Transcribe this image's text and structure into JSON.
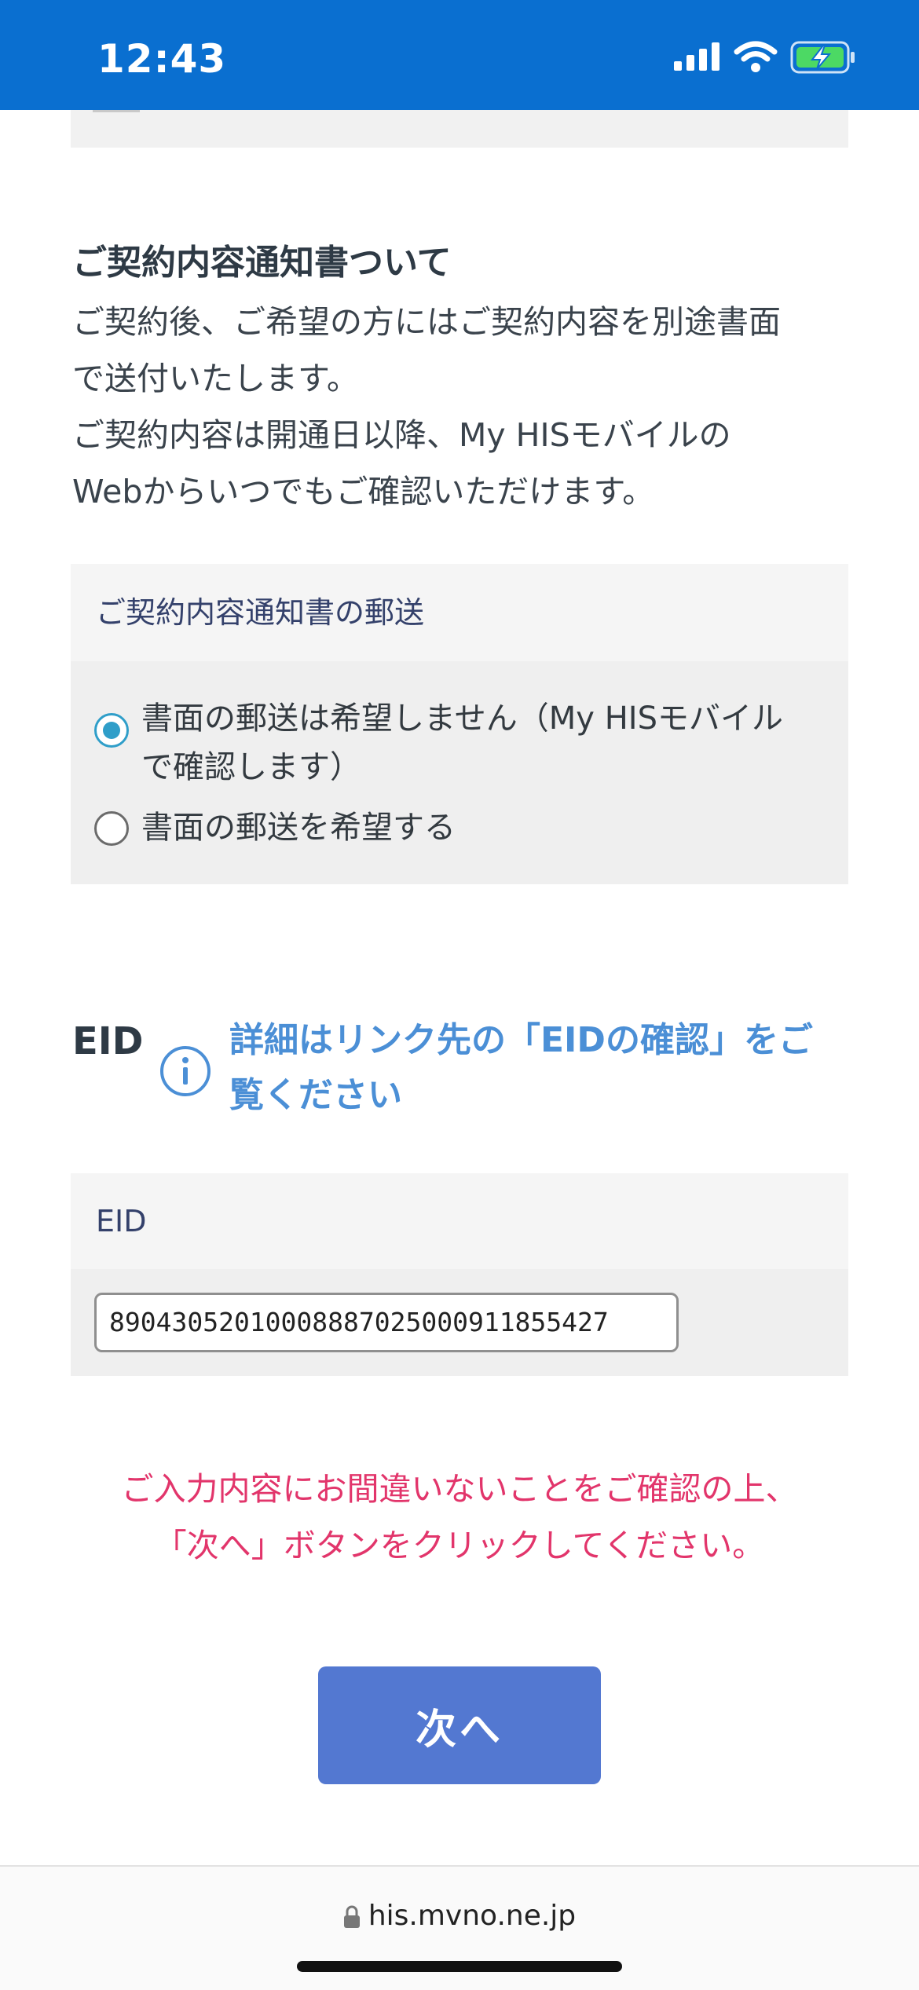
{
  "status_bar": {
    "time": "12:43",
    "icons": [
      "signal-icon",
      "wifi-icon",
      "battery-charging-icon"
    ],
    "color": "#0a6fd0"
  },
  "notification": {
    "title": "ご契約内容通知書ついて",
    "paragraph_lines": [
      "ご契約後、ご希望の方にはご契約内容を別途書面",
      "で送付いたします。",
      "ご契約内容は開通日以降、My HISモバイルの",
      "Webからいつでもご確認いただけます。"
    ],
    "card": {
      "header": "ご契約内容通知書の郵送",
      "options": [
        {
          "label_line1": "書面の郵送は希望しません（My HISモバイル",
          "label_line2": "で確認します）",
          "selected": true
        },
        {
          "label_line1": "書面の郵送を希望する",
          "selected": false
        }
      ]
    }
  },
  "eid": {
    "heading": "EID",
    "info_icon": "info-icon",
    "link_line1": "詳細はリンク先の「EIDの確認」をご",
    "link_line2": "覧ください",
    "card_header": "EID",
    "value": "89043052010008887025000911855427"
  },
  "warning": {
    "line1": "ご入力内容にお間違いないことをご確認の上、",
    "line2": "「次へ」ボタンをクリックしてください。",
    "color": "#e2356b"
  },
  "next_button": {
    "label": "次へ",
    "color": "#5378d1"
  },
  "browser": {
    "url": "his.mvno.ne.jp",
    "lock_icon": "lock-icon"
  }
}
